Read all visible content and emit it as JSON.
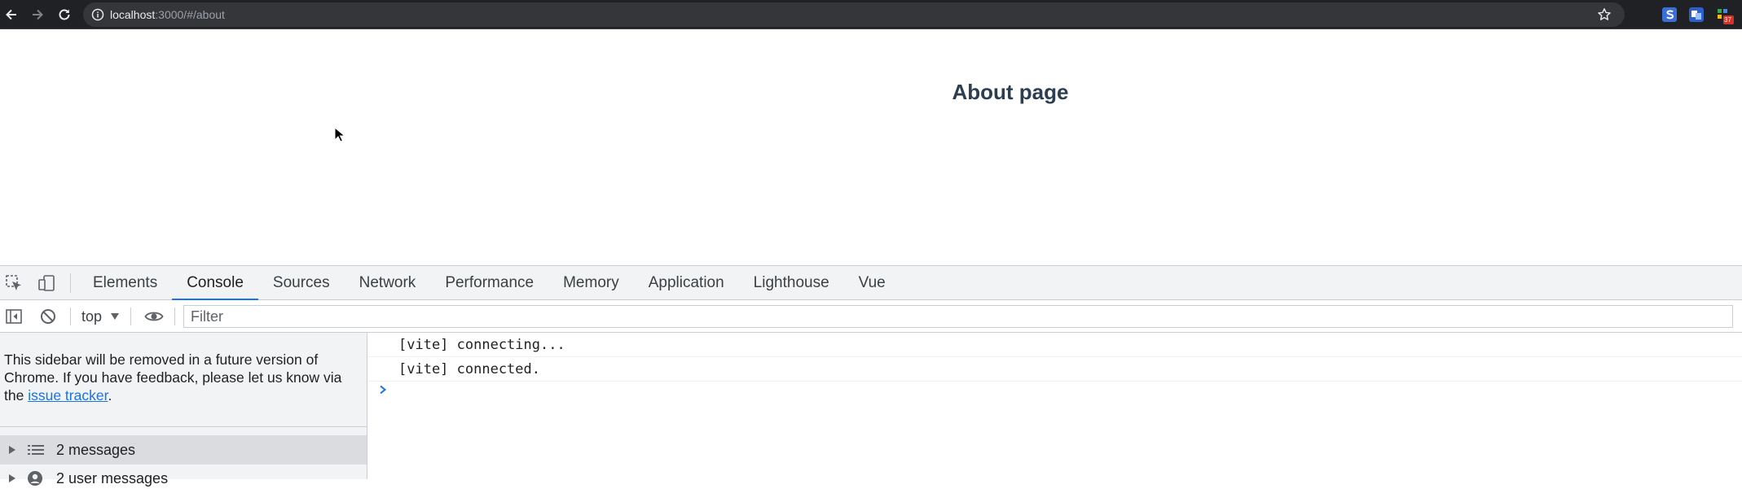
{
  "browser": {
    "url_host": "localhost",
    "url_rest": ":3000/#/about",
    "extension_badge": "37"
  },
  "page": {
    "heading": "About page"
  },
  "devtools": {
    "tabs": [
      "Elements",
      "Console",
      "Sources",
      "Network",
      "Performance",
      "Memory",
      "Application",
      "Lighthouse",
      "Vue"
    ],
    "active_tab": "Console",
    "context": "top",
    "filter_placeholder": "Filter",
    "sidebar": {
      "notice_text": "This sidebar will be removed in a future version of Chrome. If you have feedback, please let us know via the",
      "notice_link": "issue tracker",
      "notice_end": ".",
      "items": [
        {
          "label": "2 messages",
          "icon": "list-icon"
        },
        {
          "label": "2 user messages",
          "icon": "user-icon"
        }
      ]
    },
    "console": {
      "lines": [
        "[vite] connecting...",
        "[vite] connected."
      ]
    },
    "colors": {
      "accent": "#1a73e8",
      "toolbar_bg": "#202124",
      "panel_bg": "#f1f3f4"
    }
  }
}
